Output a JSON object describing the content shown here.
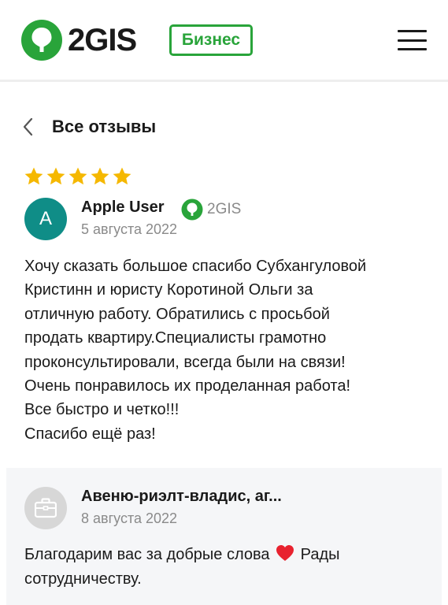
{
  "header": {
    "logo_text": "2GIS",
    "business_badge": "Бизнес",
    "brand_color": "#29a43a",
    "menu_icon": "hamburger-menu-icon"
  },
  "nav": {
    "back_icon": "chevron-left-icon",
    "title": "Все отзывы"
  },
  "review": {
    "rating": 5,
    "max_rating": 5,
    "star_color": "#f5b800",
    "avatar_letter": "A",
    "avatar_color": "#0f8d87",
    "author": "Apple User",
    "source": "2GIS",
    "date": "5 августа 2022",
    "text_lines": [
      "Хочу сказать большое спасибо Субхангуловой",
      "Кристинн и юристу Коротиной Ольги за",
      "отличную работу. Обратились с просьбой",
      "продать квартиру.Специалисты грамотно",
      "проконсультировали, всегда были на связи!",
      "Очень понравилось их проделанная работа!",
      "Все быстро и четко!!!",
      "Спасибо ещё раз!"
    ]
  },
  "reply": {
    "avatar_icon": "briefcase-icon",
    "author": "Авеню-риэлт-владис, аг...",
    "date": "8 августа 2022",
    "text_line1_before": "Благодарим вас за добрые слова",
    "text_line1_after": "Рады",
    "text_line2": "сотрудничеству.",
    "emoji": "heart-emoji"
  }
}
